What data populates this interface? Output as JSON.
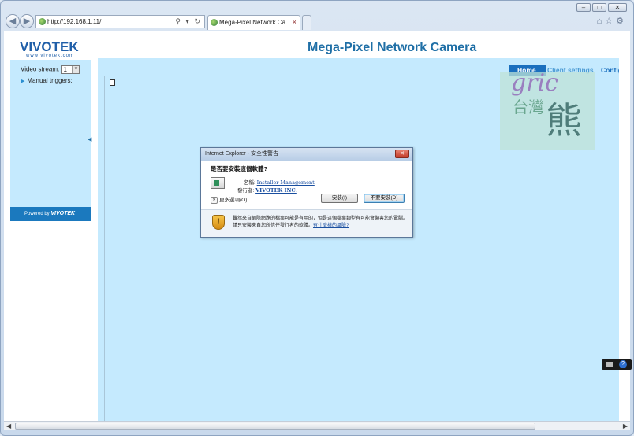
{
  "browser": {
    "address": "http://192.168.1.11/",
    "tab_title": "Mega-Pixel Network Ca...",
    "tab_close": "×",
    "addr_tools": "⚲ ▾ ↻"
  },
  "page": {
    "logo": "VIVOTEK",
    "logo_sub": "www.vivotek.com",
    "title": "Mega-Pixel Network Camera",
    "sidebar": {
      "video_stream_label": "Video stream:",
      "video_stream_value": "1",
      "manual_triggers": "Manual triggers:",
      "powered_by": "Powered by",
      "powered_brand": "VIVOTEK"
    },
    "menu": {
      "home": "Home",
      "client_settings": "Client settings",
      "config": "Config"
    },
    "watermark": {
      "script": "gric",
      "c1": "台灣",
      "c2": "熊"
    }
  },
  "dialog": {
    "title": "Internet Explorer - 安全性警告",
    "question": "是否要安裝這個軟體?",
    "name_label": "名稱:",
    "name_value": "Installer Management",
    "publisher_label": "發行者:",
    "publisher_value": "VIVOTEK INC.",
    "more_options": "更多選項(O)",
    "install_button": "安裝(I)",
    "no_install_button": "不要安裝(D)",
    "warning_text": "雖然來自網際網路的檔案可能是有用的，但是這個檔案類型有可能會傷害您的電腦。請只安裝來自您所信任發行者的軟體。",
    "warning_link": "有什麼樣的風險?"
  }
}
